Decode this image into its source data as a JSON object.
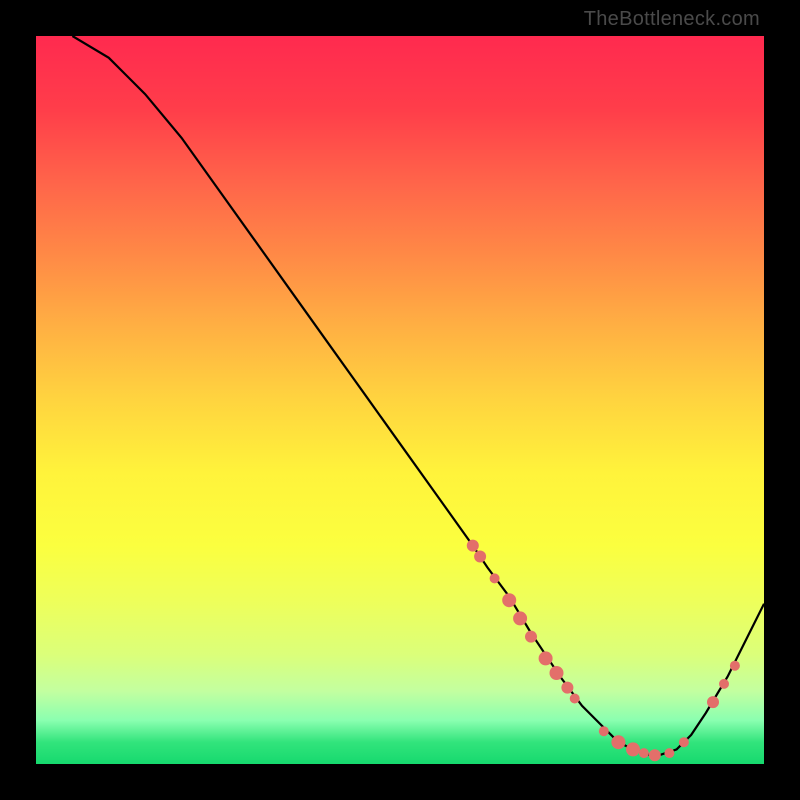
{
  "watermark": "TheBottleneck.com",
  "chart_data": {
    "type": "line",
    "title": "",
    "xlabel": "",
    "ylabel": "",
    "xlim": [
      0,
      100
    ],
    "ylim": [
      0,
      100
    ],
    "series": [
      {
        "name": "curve",
        "x": [
          5,
          10,
          15,
          20,
          25,
          30,
          35,
          40,
          45,
          50,
          55,
          60,
          62,
          65,
          68,
          70,
          72,
          75,
          78,
          80,
          82,
          85,
          88,
          90,
          92,
          95,
          100
        ],
        "y": [
          100,
          97,
          92,
          86,
          79,
          72,
          65,
          58,
          51,
          44,
          37,
          30,
          27,
          23,
          18,
          15,
          12,
          8,
          5,
          3,
          2,
          1,
          2,
          4,
          7,
          12,
          22
        ]
      }
    ],
    "markers": [
      {
        "x": 60,
        "y": 30,
        "r": 6
      },
      {
        "x": 61,
        "y": 28.5,
        "r": 6
      },
      {
        "x": 63,
        "y": 25.5,
        "r": 5
      },
      {
        "x": 65,
        "y": 22.5,
        "r": 7
      },
      {
        "x": 66.5,
        "y": 20,
        "r": 7
      },
      {
        "x": 68,
        "y": 17.5,
        "r": 6
      },
      {
        "x": 70,
        "y": 14.5,
        "r": 7
      },
      {
        "x": 71.5,
        "y": 12.5,
        "r": 7
      },
      {
        "x": 73,
        "y": 10.5,
        "r": 6
      },
      {
        "x": 74,
        "y": 9,
        "r": 5
      },
      {
        "x": 78,
        "y": 4.5,
        "r": 5
      },
      {
        "x": 80,
        "y": 3,
        "r": 7
      },
      {
        "x": 82,
        "y": 2,
        "r": 7
      },
      {
        "x": 83.5,
        "y": 1.5,
        "r": 5
      },
      {
        "x": 85,
        "y": 1.2,
        "r": 6
      },
      {
        "x": 87,
        "y": 1.5,
        "r": 5
      },
      {
        "x": 89,
        "y": 3,
        "r": 5
      },
      {
        "x": 93,
        "y": 8.5,
        "r": 6
      },
      {
        "x": 94.5,
        "y": 11,
        "r": 5
      },
      {
        "x": 96,
        "y": 13.5,
        "r": 5
      }
    ],
    "marker_color": "#e36f6a",
    "curve_color": "#000000"
  }
}
